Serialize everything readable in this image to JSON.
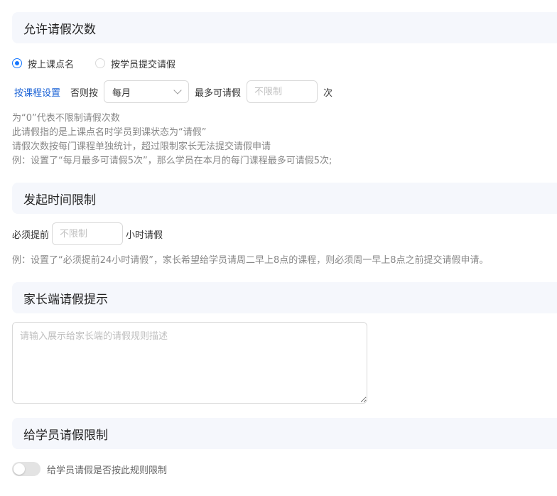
{
  "sections": {
    "leave_count": "允许请假次数",
    "time_limit": "发起时间限制",
    "parent_tip": "家长端请假提示",
    "student_limit": "给学员请假限制"
  },
  "leave_count": {
    "radio_by_rollcall": "按上课点名",
    "radio_by_submit": "按学员提交请假",
    "course_setting_link": "按课程设置",
    "otherwise_label": "否则按",
    "period_value": "每月",
    "max_label": "最多可请假",
    "max_placeholder": "不限制",
    "times_unit": "次",
    "hints": [
      "为“0”代表不限制请假次数",
      "此请假指的是上课点名时学员到课状态为“请假”",
      "请假次数按每门课程单独统计，超过限制家长无法提交请假申请",
      "例：设置了“每月最多可请假5次”，那么学员在本月的每门课程最多可请假5次;"
    ]
  },
  "time_limit": {
    "prefix": "必须提前",
    "placeholder": "不限制",
    "suffix": "小时请假",
    "hint": "例：设置了“必须提前24小时请假”，家长希望给学员请周二早上8点的课程，则必须周一早上8点之前提交请假申请。"
  },
  "parent_tip": {
    "placeholder": "请输入展示给家长端的请假规则描述"
  },
  "student_limit": {
    "switch_label": "给学员请假是否按此规则限制",
    "enabled": false
  },
  "colors": {
    "accent": "#1677ff",
    "link": "#1a62d6",
    "section_bg": "#f5f7fc"
  }
}
